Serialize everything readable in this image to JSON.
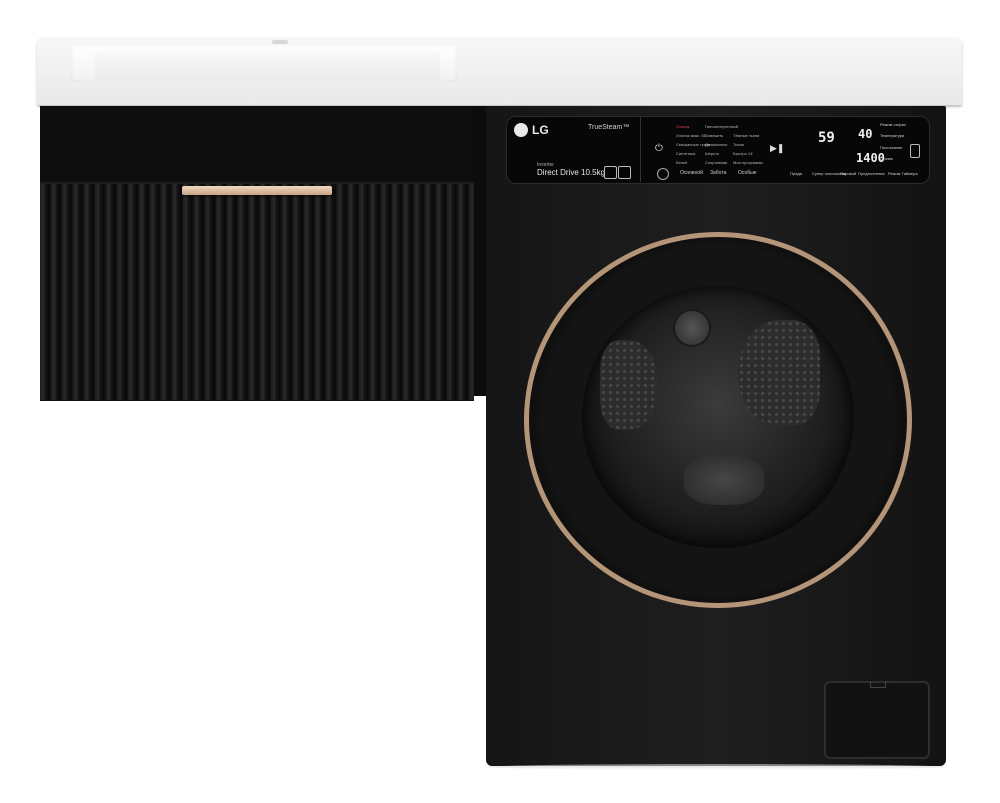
{
  "panel": {
    "brand": "LG",
    "feature": "TrueSteam™",
    "inverter": "Inverter",
    "model": "Direct Drive 10.5kg",
    "programs": [
      "Хлопок",
      "Хлопок макс. 60",
      "Смешанные ткани",
      "Синтетика",
      "Бельё",
      "Гипоаллергенный",
      "Освежить",
      "Деликатные",
      "Шерсть",
      "Спортивная",
      "Тёмные ткани",
      "Тихая",
      "Быстро 14'",
      "Мои программы"
    ],
    "categories": [
      "Основной",
      "Забота",
      "Особые"
    ],
    "display_time": "59",
    "display_temp": "40",
    "display_spin": "1400",
    "right_labels": [
      "Режим стирки",
      "Температура",
      "Полоскание",
      "Отжим"
    ],
    "options": [
      "Предв.",
      "Супер полоскание",
      "Паровой",
      "Предпочтения",
      "Режим Таймера"
    ]
  }
}
